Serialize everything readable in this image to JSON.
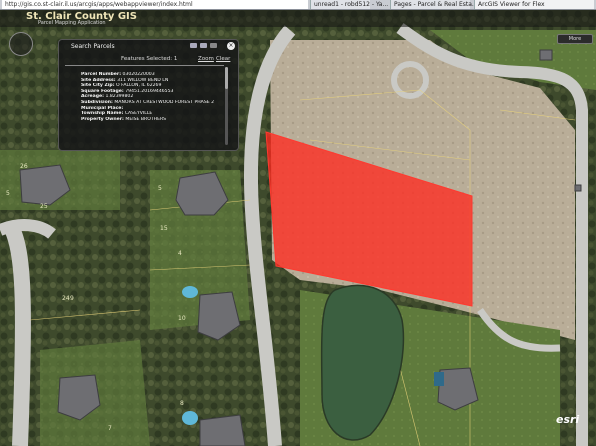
{
  "browser": {
    "url": "http://gis.co.st-clair.il.us/arcgis/apps/webappviewer/index.html",
    "tabs": [
      "unread1 - robd512 - Ya...",
      "Pages - Parcel & Real Esta...",
      "ArcGIS Viewer for Flex"
    ]
  },
  "app": {
    "title": "St. Clair County GIS",
    "subtitle": "Parcel Mapping Application",
    "more_button": "More"
  },
  "popup": {
    "title": "Search Parcels",
    "features_selected": "Features Selected: 1",
    "zoom_label": "Zoom",
    "clear_label": "Clear",
    "fields": [
      {
        "label": "Parcel Number:",
        "value": "03020220003"
      },
      {
        "label": "Site Address:",
        "value": "311 WILLOW BEND LN"
      },
      {
        "label": "Site City Zip:",
        "value": "O FALLON, IL 62269"
      },
      {
        "label": "Square Footage:",
        "value": "79451.20169446553"
      },
      {
        "label": "Acreage:",
        "value": "1.82399802"
      },
      {
        "label": "Subdivision:",
        "value": "MANORS AT CRESTWOOD FOREST PHASE 2"
      },
      {
        "label": "Municipal Place:",
        "value": ""
      },
      {
        "label": "Township Name:",
        "value": "CASEYVILLE"
      },
      {
        "label": "Property Owner:",
        "value": "MEISE BROTHERS"
      }
    ]
  },
  "map": {
    "lot_labels": [
      "26",
      "25",
      "5",
      "5",
      "15",
      "4",
      "10",
      "9",
      "7",
      "8",
      "24"
    ],
    "highlight_color": "#ff2a20",
    "attribution": "esri"
  }
}
